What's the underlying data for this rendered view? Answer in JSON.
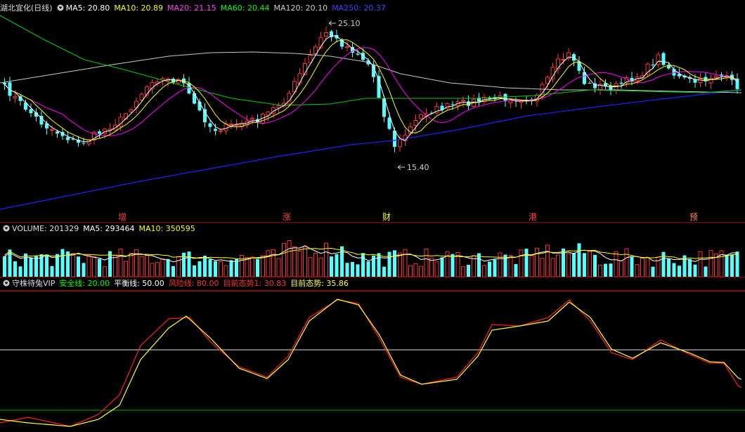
{
  "colors": {
    "up": "#ff3232",
    "down": "#54ffff",
    "ma5": "#ffffff",
    "ma10": "#ffff00",
    "ma20": "#ff00ff",
    "ma60": "#00ff00",
    "ma120": "#c8c8c8",
    "ma250": "#2020ff",
    "grid": "#8b0000",
    "ind_red": "#ff2020",
    "ind_yellow": "#ffff40",
    "safe": "#00d000"
  },
  "price_panel": {
    "stock": "湖北宜化(日线)",
    "ma5": "MA5: 20.80",
    "ma10": "MA10: 20.89",
    "ma20": "MA20: 21.15",
    "ma60": "MA60: 20.44",
    "ma120": "MA120: 20.10",
    "ma250": "MA250: 20.37",
    "high_label": "25.10",
    "low_label": "15.40"
  },
  "markers": [
    {
      "text": "增",
      "color": "#ff4040"
    },
    {
      "text": "涨",
      "color": "#ff4040"
    },
    {
      "text": "财",
      "color": "#ffff00"
    },
    {
      "text": "港",
      "color": "#ff4040"
    },
    {
      "text": "预",
      "color": "#ff8040"
    }
  ],
  "volume_panel": {
    "title": "VOLUME: 201329",
    "ma5": "MA5: 293464",
    "ma10": "MA10: 350595"
  },
  "indicator_panel": {
    "title": "守株待兔VIP",
    "safe": "安全线: 20.00",
    "balance": "平衡线: 50.00",
    "risk": "风险线: 80.00",
    "trend1": "目前态势1: 30.83",
    "trend": "目前态势: 35.86"
  }
}
